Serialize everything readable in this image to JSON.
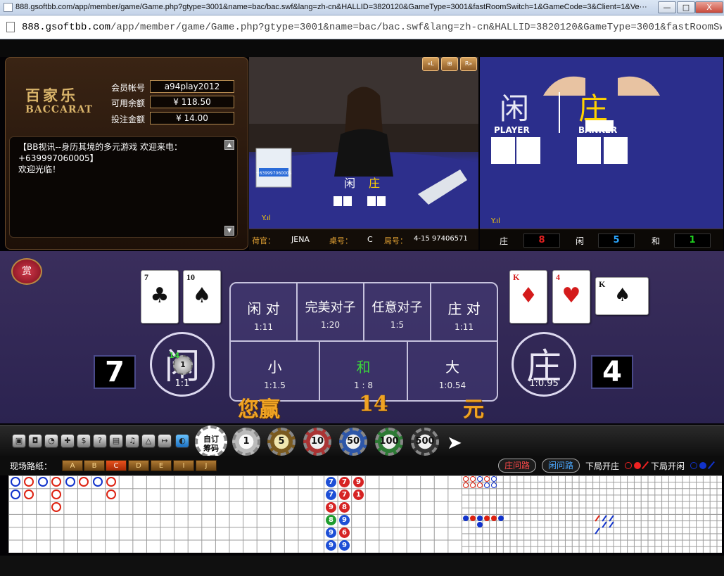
{
  "window": {
    "title": "888.gsoftbb.com/app/member/game/Game.php?gtype=3001&name=bac/bac.swf&lang=zh-cn&HALLID=3820120&GameType=3001&fastRoomSwitch=1&GameCode=3&Client=1&Ve···",
    "btn_min": "—",
    "btn_max": "□",
    "btn_close": "X"
  },
  "address": {
    "host": "888.gsoftbb.com",
    "path": "/app/member/game/Game.php?gtype=3001&name=bac/bac.swf&lang=zh-cn&HALLID=3820120&GameType=3001&fastRoomSwitch=1&GameCode=3&Client=1&Ve"
  },
  "brand": {
    "cn": "百家乐",
    "en": "BACCARAT"
  },
  "account": {
    "member_label": "会员帐号",
    "member_value": "a94play2012",
    "balance_label": "可用余额",
    "balance_value": "¥ 118.50",
    "bet_label": "投注金额",
    "bet_value": "¥ 14.00"
  },
  "message": {
    "line1": "【BB视讯--身历其境的多元游戏  欢迎来电：",
    "line2": "+639997060005】",
    "line3": "  欢迎光临！"
  },
  "video": {
    "ctrl_labels": [
      "«L",
      "⊞",
      "R»"
    ],
    "screen_text": "+639997060005",
    "player_cn": "闲",
    "player_en": "PLAYER",
    "banker_cn": "庄",
    "banker_en": "BANKER",
    "signal_icon": "signal-icon"
  },
  "dealer": {
    "dealer_label": "荷官：",
    "dealer_value": "JENA",
    "table_label": "桌号：",
    "table_value": "C",
    "round_label": "局号：",
    "round_value": "4-15 97406571"
  },
  "score": {
    "banker_label": "庄",
    "banker_value": "8",
    "player_label": "闲",
    "player_value": "5",
    "tie_label": "和",
    "tie_value": "1",
    "banker_color": "#e02020",
    "player_color": "#2aa6ff",
    "tie_color": "#1fd01f"
  },
  "reward": {
    "label": "赏"
  },
  "cards": {
    "player": [
      {
        "rank": "7",
        "suit": "♣",
        "color": "black"
      },
      {
        "rank": "10",
        "suit": "♠",
        "color": "black"
      }
    ],
    "banker": [
      {
        "rank": "K",
        "suit": "♦",
        "color": "red"
      },
      {
        "rank": "4",
        "suit": "♥",
        "color": "red"
      },
      {
        "rank": "K",
        "suit": "♠",
        "color": "black",
        "sideways": true
      }
    ]
  },
  "bets": {
    "player_pair": {
      "name": "闲 对",
      "odds": "1:11"
    },
    "perfect_pair": {
      "name": "完美对子",
      "odds": "1:20"
    },
    "either_pair": {
      "name": "任意对子",
      "odds": "1:5"
    },
    "banker_pair": {
      "name": "庄 对",
      "odds": "1:11"
    },
    "small": {
      "name": "小",
      "odds": "1:1.5"
    },
    "tie": {
      "name": "和",
      "odds": "1 : 8"
    },
    "big": {
      "name": "大",
      "odds": "1:0.54"
    },
    "player": {
      "name": "闲",
      "odds": "1:1",
      "chip": "1",
      "chip_amount": "14"
    },
    "banker": {
      "name": "庄",
      "odds": "1:0.95"
    }
  },
  "totals": {
    "player": "7",
    "banker": "4"
  },
  "win": {
    "prefix": "您赢",
    "amount": "14",
    "unit": "元"
  },
  "toolbar": {
    "icons": [
      "screen-icon",
      "camera-icon",
      "rss-icon",
      "gift-icon",
      "dollar-icon",
      "help-icon",
      "history-icon",
      "music-icon",
      "warning-icon",
      "exit-icon",
      "sound-icon"
    ],
    "self_chip": "自订\n筹码",
    "chips": [
      "1",
      "5",
      "10",
      "50",
      "100",
      "500"
    ]
  },
  "roadmap": {
    "label": "现场路纸：",
    "tabs": [
      "A",
      "B",
      "C",
      "D",
      "E",
      "I",
      "J"
    ],
    "active_tab": "C",
    "ask_banker": "庄问路",
    "ask_player": "闲问路",
    "next_banker": "下局开庄",
    "next_player": "下局开闲",
    "banker_color": "#d21",
    "player_color": "#13c"
  }
}
